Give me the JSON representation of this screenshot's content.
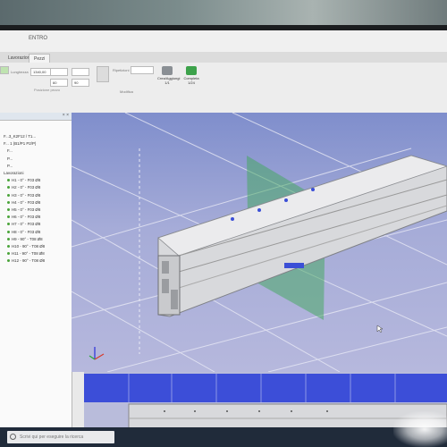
{
  "window": {
    "title": "ENTRO"
  },
  "tabs": [
    {
      "label": "Lavorazioni"
    },
    {
      "label": "Pezzi"
    }
  ],
  "ribbon": {
    "length_label": "Lunghezza",
    "length_value": "1340,00",
    "fields": [
      "60",
      "90"
    ],
    "group_label": "Posizione pezzo",
    "rip_label": "Ripetizioni",
    "btn_conta": "Crea/Aggiungi\n1/1",
    "btn_completa": "Completa\n1/24",
    "status_label": "Modifica"
  },
  "tree": {
    "header": "",
    "items": [
      {
        "label": "F...3_K2F12 / T1...",
        "indent": false,
        "dot": false
      },
      {
        "label": "F...  1 (B1/P1 P2/P)",
        "indent": false,
        "dot": false
      },
      {
        "label": "F...",
        "indent": true,
        "dot": false
      },
      {
        "label": "P...",
        "indent": true,
        "dot": false
      },
      {
        "label": "P...",
        "indent": true,
        "dot": false
      },
      {
        "label": "Lavorazioni",
        "indent": false,
        "dot": false
      },
      {
        "label": "H1 - 0° - F03 Ø8",
        "indent": true,
        "dot": true
      },
      {
        "label": "H2 - 0° - F03 Ø8",
        "indent": true,
        "dot": true
      },
      {
        "label": "H3 - 0° - F03 Ø8",
        "indent": true,
        "dot": true
      },
      {
        "label": "H4 - 0° - F03 Ø8",
        "indent": true,
        "dot": true
      },
      {
        "label": "H5 - 0° - F03 Ø8",
        "indent": true,
        "dot": true
      },
      {
        "label": "H6 - 0° - F03 Ø8",
        "indent": true,
        "dot": true
      },
      {
        "label": "H7 - 0° - F03 Ø8",
        "indent": true,
        "dot": true
      },
      {
        "label": "H8 - 0° - F03 Ø8",
        "indent": true,
        "dot": true
      },
      {
        "label": "H9 - 90° - T08 Ø8",
        "indent": true,
        "dot": true
      },
      {
        "label": "H10 - 90° - T08 Ø8",
        "indent": true,
        "dot": true
      },
      {
        "label": "H11 - 90° - T08 Ø8",
        "indent": true,
        "dot": true
      },
      {
        "label": "H12 - 90° - T08 Ø8",
        "indent": true,
        "dot": true
      }
    ]
  },
  "taskbar": {
    "search_placeholder": "Scrivi qui per eseguire la ricerca"
  },
  "colors": {
    "viewport_top": "#7f8ecc",
    "viewport_bottom": "#b6b8dd",
    "profile": "#d9dadd",
    "plane": "#3fa85a"
  }
}
